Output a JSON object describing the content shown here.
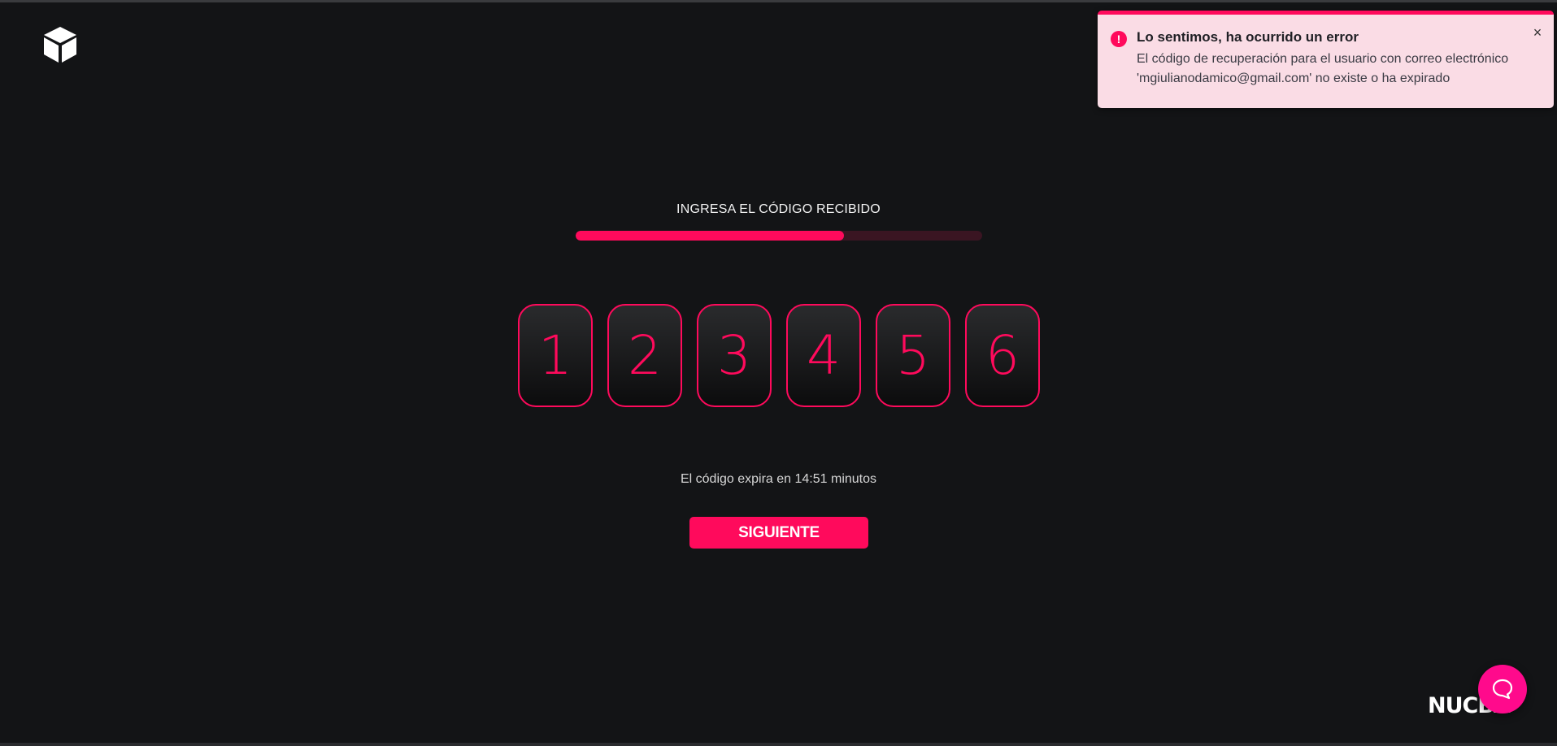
{
  "toast": {
    "icon": "alert-circle-icon",
    "title": "Lo sentimos, ha ocurrido un error",
    "message": "El código de recuperación para el usuario con correo electrónico 'mgiulianodamico@gmail.com' no existe o ha expirado",
    "close_label": "×"
  },
  "step": {
    "title": "INGRESA EL CÓDIGO RECIBIDO",
    "progress_fraction": 0.66
  },
  "code": {
    "digits": [
      "1",
      "2",
      "3",
      "4",
      "5",
      "6"
    ]
  },
  "expiry_text": "El código expira en 14:51 minutos",
  "next_button_label": "SIGUIENTE",
  "brand_name": "NUCBA",
  "icons": {
    "logo": "cube-logo-icon",
    "chat": "chat-bubble-icon"
  },
  "colors": {
    "accent": "#ff0a5c",
    "background": "#131416",
    "toast_bg": "#fadce5"
  }
}
